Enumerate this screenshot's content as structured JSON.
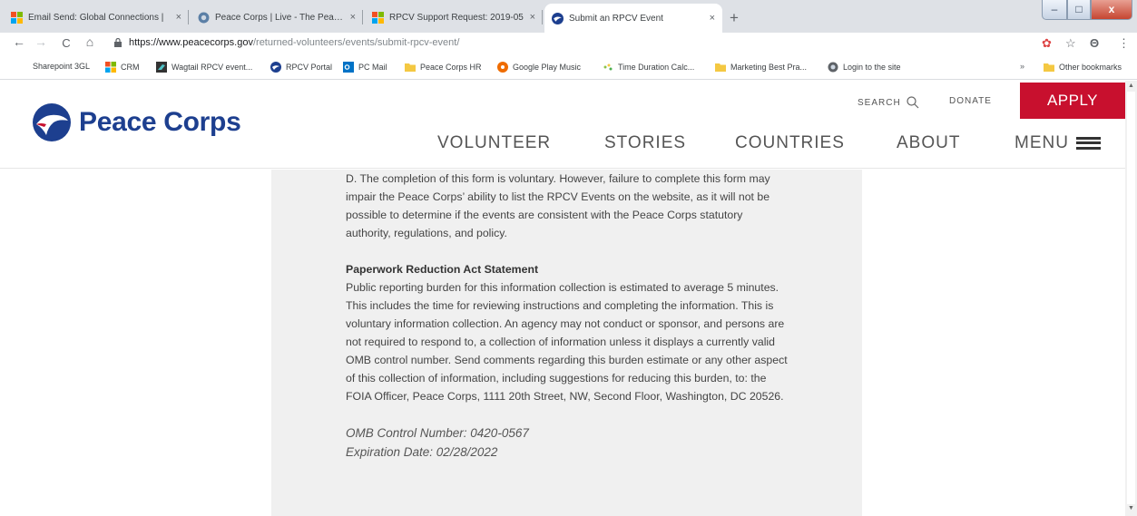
{
  "browser": {
    "tabs": [
      {
        "title": "Email Send: Global Connections |",
        "active": false
      },
      {
        "title": "Peace Corps | Live - The Peace C",
        "active": false
      },
      {
        "title": "RPCV Support Request: 2019-05",
        "active": false
      },
      {
        "title": "Submit an RPCV Event",
        "active": true
      }
    ],
    "tab_close": "×",
    "new_tab": "+",
    "window_controls": {
      "minimize": "–",
      "maximize": "□",
      "close": "x"
    },
    "url_host": "https://www.peacecorps.gov",
    "url_path": "/returned-volunteers/events/submit-rpcv-event/",
    "nav": {
      "back": "←",
      "forward": "→",
      "reload": "C",
      "home": "⌂"
    },
    "toolbar_icons": {
      "extension": "✿",
      "star": "☆",
      "profile": "Θ",
      "more": "⋮"
    },
    "bookmarks": [
      "Sharepoint 3GL",
      "CRM",
      "Wagtail RPCV event...",
      "RPCV Portal",
      "PC Mail",
      "Peace Corps HR",
      "Google Play Music",
      "Time Duration Calc...",
      "Marketing Best Pra...",
      "Login to the site"
    ],
    "bookmarks_overflow": "»",
    "other_bookmarks": "Other bookmarks"
  },
  "site": {
    "logo_text": "Peace Corps",
    "search_label": "SEARCH",
    "donate_label": "DONATE",
    "apply_label": "APPLY",
    "nav": [
      "VOLUNTEER",
      "STORIES",
      "COUNTRIES",
      "ABOUT"
    ],
    "menu_label": "MENU"
  },
  "content": {
    "para_d": "D. The completion of this form is voluntary. However, failure to complete this form may impair the Peace Corps’ ability to list the RPCV Events on the website, as it will not be possible to determine if the events are consistent with the Peace Corps statutory authority, regulations, and policy.",
    "pra_title": "Paperwork Reduction Act Statement",
    "pra_body": "Public reporting burden for this information collection is estimated to average 5 minutes. This includes the time for reviewing instructions and completing the information. This is voluntary information collection. An agency may not conduct or sponsor, and persons are not required to respond to, a collection of information unless it displays a currently valid OMB control number. Send comments regarding this burden estimate or any other aspect of this collection of information, including suggestions for reducing this burden, to: the FOIA Officer, Peace Corps, 1111 20th Street, NW, Second Floor, Washington, DC 20526.",
    "omb_number": "OMB Control Number: 0420-0567",
    "expiration": "Expiration Date: 02/28/2022"
  },
  "colors": {
    "brand_blue": "#1d3f8f",
    "apply_red": "#c8102e"
  }
}
